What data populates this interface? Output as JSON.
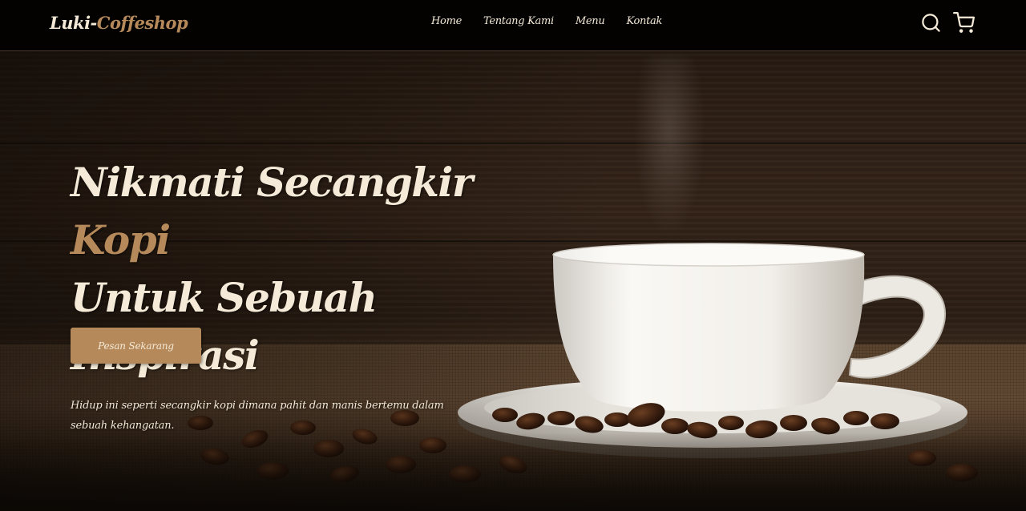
{
  "navbar": {
    "brand_main": "Luki-",
    "brand_accent": "Coffeshop",
    "links": [
      {
        "label": "Home"
      },
      {
        "label": "Tentang Kami"
      },
      {
        "label": "Menu"
      },
      {
        "label": "Kontak"
      }
    ],
    "icons": [
      "search-icon",
      "shopping-cart-icon"
    ]
  },
  "hero": {
    "title_part1": "Nikmati Secangkir",
    "title_accent": "Kopi",
    "title_line2": "Untuk Sebuah Inspirasi",
    "description": "Hidup ini seperti secangkir kopi dimana pahit dan manis bertemu dalam sebuah kehangatan.",
    "cta_label": "Pesan Sekarang"
  },
  "colors": {
    "accent": "#b6895b",
    "text_light": "#f4ead7",
    "navbar_bg": "#030201"
  }
}
